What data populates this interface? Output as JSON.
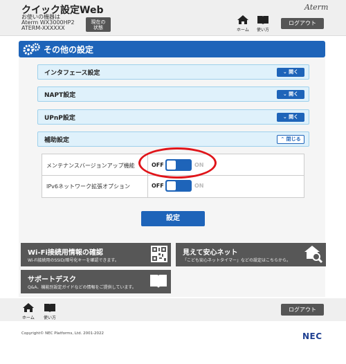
{
  "header": {
    "title": "クイック設定Web",
    "line1": "お使いの機器は",
    "line2": "Aterm  WX3000HP2",
    "line3": "ATERM-XXXXXX",
    "status_line1": "現在の",
    "status_line2": "状態",
    "brand": "Aterm",
    "home_label": "ホーム",
    "guide_label": "使い方",
    "logout": "ログアウト"
  },
  "section": {
    "title": "その他の設定"
  },
  "accordions": [
    {
      "label": "インタフェース設定",
      "button": "開く"
    },
    {
      "label": "NAPT設定",
      "button": "開く"
    },
    {
      "label": "UPnP設定",
      "button": "開く"
    },
    {
      "label": "補助設定",
      "button": "閉じる"
    }
  ],
  "settings": [
    {
      "label": "メンテナンスバージョンアップ機能",
      "off": "OFF",
      "on": "ON"
    },
    {
      "label": "IPv6ネットワーク拡張オプション",
      "off": "OFF",
      "on": "ON"
    }
  ],
  "submit": "設定",
  "cards": {
    "wifi": {
      "title": "Wi-Fi接続用情報の確認",
      "desc": "Wi-Fi接続用のSSID/暗号化キーを確認できます。"
    },
    "mieru": {
      "title": "見えて安心ネット",
      "desc": "「こども安心ネットタイマー」などの設定はこちらから。"
    },
    "support": {
      "title": "サポートデスク",
      "desc": "Q&A、機能別設定ガイドなどの情報をご提供しています。"
    }
  },
  "footer": {
    "home_label": "ホーム",
    "guide_label": "使い方",
    "logout": "ログアウト",
    "copyright": "Copyright© NEC Platforms, Ltd. 2001-2022",
    "nec": "NEC"
  },
  "colors": {
    "accent": "#1e64b9",
    "highlight": "#e0151a",
    "card": "#575757"
  }
}
